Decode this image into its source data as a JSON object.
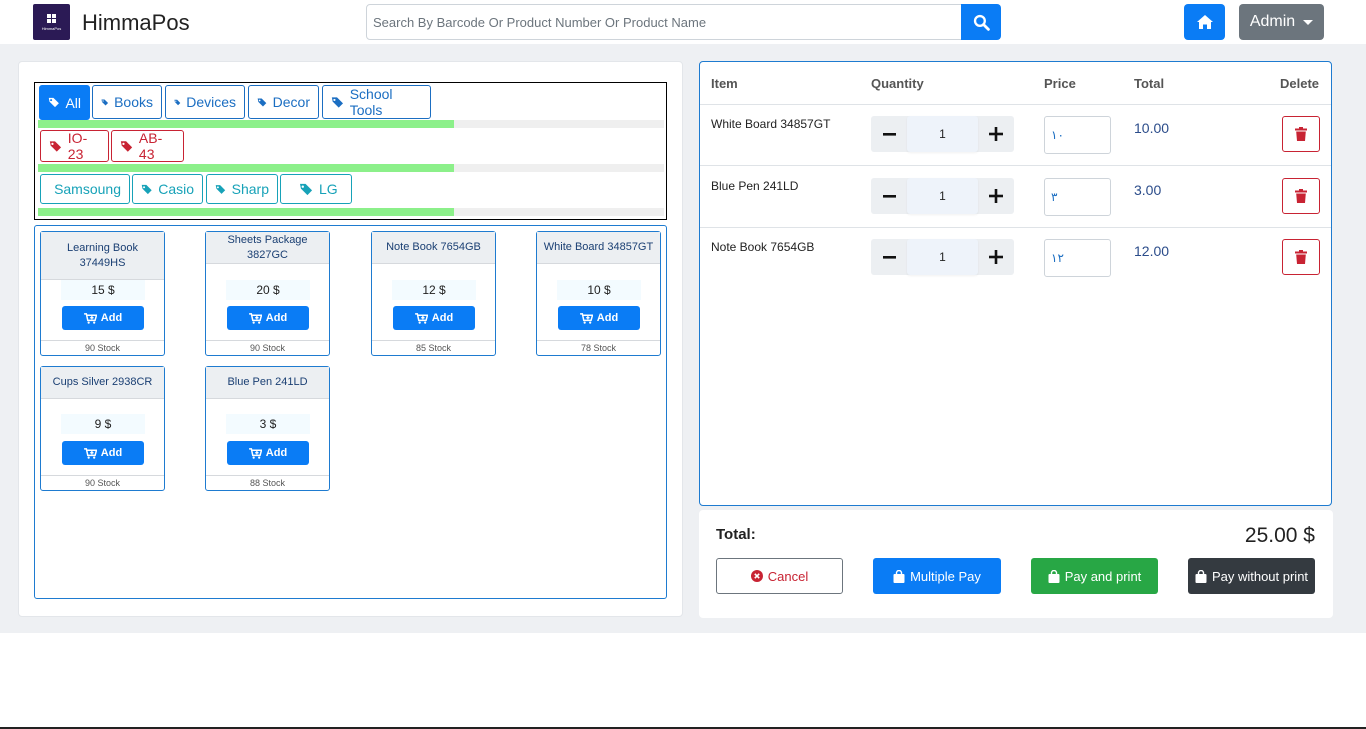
{
  "header": {
    "brand": "HimmaPos",
    "logo_text": "HimmaPos",
    "search_placeholder": "Search By Barcode Or Product Number Or Product Name",
    "admin_label": "Admin"
  },
  "categories": {
    "row1": [
      {
        "label": "All",
        "active": true
      },
      {
        "label": "Books"
      },
      {
        "label": "Devices"
      },
      {
        "label": "Decor"
      },
      {
        "label": "School Tools"
      }
    ],
    "row2": [
      {
        "label": "IO-23"
      },
      {
        "label": "AB-43"
      }
    ],
    "row3": [
      {
        "label": "Samsoung"
      },
      {
        "label": "Casio"
      },
      {
        "label": "Sharp"
      },
      {
        "label": "LG"
      }
    ]
  },
  "products": [
    {
      "name": "Learning Book 37449HS",
      "price": "15 $",
      "add_label": "Add",
      "stock": "90 Stock"
    },
    {
      "name": "Sheets Package 3827GC",
      "price": "20 $",
      "add_label": "Add",
      "stock": "90 Stock"
    },
    {
      "name": "Note Book 7654GB",
      "price": "12 $",
      "add_label": "Add",
      "stock": "85 Stock"
    },
    {
      "name": "White Board 34857GT",
      "price": "10 $",
      "add_label": "Add",
      "stock": "78 Stock"
    },
    {
      "name": "Cups Silver 2938CR",
      "price": "9 $",
      "add_label": "Add",
      "stock": "90 Stock"
    },
    {
      "name": "Blue Pen 241LD",
      "price": "3 $",
      "add_label": "Add",
      "stock": "88 Stock"
    }
  ],
  "cart": {
    "headers": {
      "item": "Item",
      "quantity": "Quantity",
      "price": "Price",
      "total": "Total",
      "delete": "Delete"
    },
    "rows": [
      {
        "item": "White Board 34857GT",
        "qty": "1",
        "price": "١٠",
        "total": "10.00"
      },
      {
        "item": "Blue Pen 241LD",
        "qty": "1",
        "price": "٣",
        "total": "3.00"
      },
      {
        "item": "Note Book 7654GB",
        "qty": "1",
        "price": "١٢",
        "total": "12.00"
      }
    ]
  },
  "summary": {
    "total_label": "Total:",
    "total_value": "25.00 $",
    "cancel": "Cancel",
    "multiple_pay": "Multiple Pay",
    "pay_print": "Pay and print",
    "pay_no_print": "Pay without print"
  },
  "colors": {
    "primary": "#0a7cf5",
    "danger": "#c82333",
    "success": "#28a745",
    "dark": "#343a40",
    "secondary": "#6c757d",
    "info": "#17a2b8",
    "progress": "#8cf08a"
  }
}
